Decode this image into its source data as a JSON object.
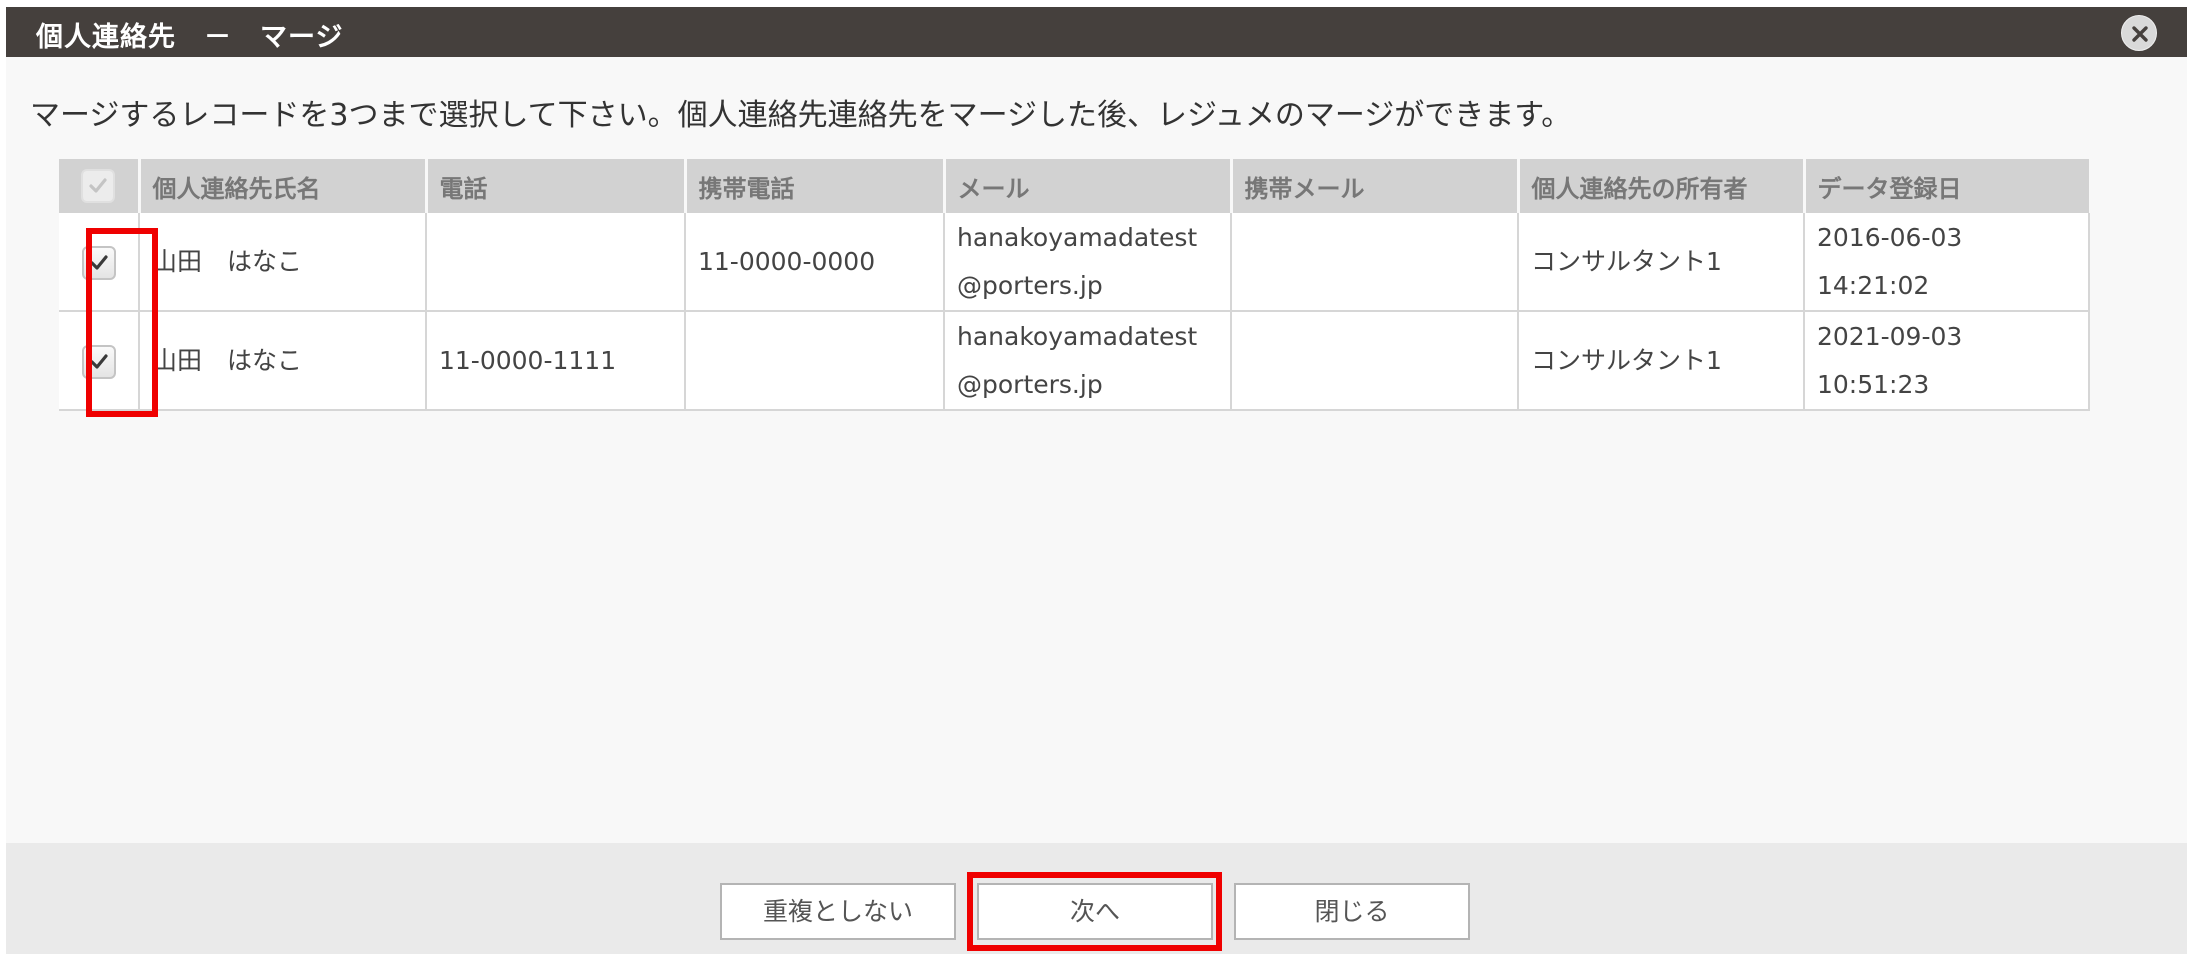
{
  "dialog": {
    "title": "個人連絡先　－　マージ",
    "close_icon": "close-icon",
    "instruction": "マージするレコードを3つまで選択して下さい。個人連絡先連絡先をマージした後、レジュメのマージができます。"
  },
  "table": {
    "columns": [
      "個人連絡先氏名",
      "電話",
      "携帯電話",
      "メール",
      "携帯メール",
      "個人連絡先の所有者",
      "データ登録日"
    ],
    "rows": [
      {
        "checked": true,
        "name": "山田　はなこ",
        "phone": "",
        "mobile": "11-0000-0000",
        "email_line1": "hanakoyamadatest",
        "email_line2": "@porters.jp",
        "mobile_email": "",
        "owner": "コンサルタント1",
        "date": "2016-06-03",
        "time": "14:21:02"
      },
      {
        "checked": true,
        "name": "山田　はなこ",
        "phone": "11-0000-1111",
        "mobile": "",
        "email_line1": "hanakoyamadatest",
        "email_line2": "@porters.jp",
        "mobile_email": "",
        "owner": "コンサルタント1",
        "date": "2021-09-03",
        "time": "10:51:23"
      }
    ]
  },
  "footer": {
    "no_duplicate_label": "重複としない",
    "next_label": "次へ",
    "close_label": "閉じる"
  },
  "colors": {
    "titlebar": "#45403d",
    "highlight": "#ef0000",
    "header_bg": "#d2d2d2",
    "footer_bg": "#eaeaea"
  }
}
